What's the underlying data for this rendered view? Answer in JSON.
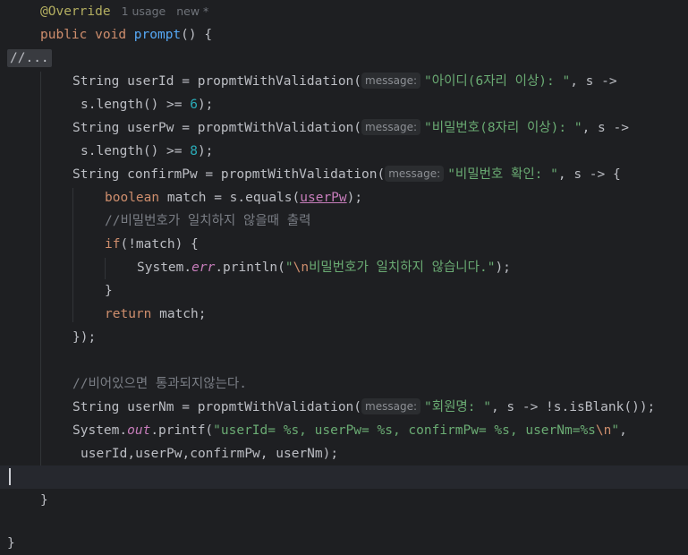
{
  "annotation": "@Override",
  "usage": "1 usage",
  "status": "new *",
  "sig": {
    "kw1": "public",
    "kw2": "void",
    "name": "prompt",
    "rest": "() {"
  },
  "fold": "//...",
  "userId": {
    "a": "String userId = ",
    "fn": "propmtWithValidation(",
    "hint": "message:",
    "str": "\"아이디(6자리 이상): \"",
    "b": ", s ->",
    "c": "s.length() >= ",
    "num": "6",
    "d": ");"
  },
  "userPw": {
    "a": "String userPw = ",
    "fn": "propmtWithValidation(",
    "hint": "message:",
    "str": "\"비밀번호(8자리 이상): \"",
    "b": ", s ->",
    "c": "s.length() >= ",
    "num": "8",
    "d": ");"
  },
  "confirm": {
    "a": "String confirmPw = ",
    "fn": "propmtWithValidation(",
    "hint": "message:",
    "str": "\"비밀번호 확인: \"",
    "b": ", s -> {"
  },
  "match": {
    "kw": "boolean",
    "a": " match = s.equals(",
    "var": "userPw",
    "b": ");"
  },
  "comment1": "//비밀번호가 일치하지 않을때 출력",
  "ifline": {
    "kw": "if",
    "a": "(!match) {"
  },
  "println": {
    "a": "System.",
    "st": "err",
    "b": ".println(",
    "s1": "\"",
    "esc": "\\n",
    "s2": "비밀번호가 일치하지 않습니다.\"",
    "c": ");"
  },
  "closeBrace": "}",
  "ret": {
    "kw": "return",
    "a": " match;"
  },
  "closeCall": "});",
  "comment2": "//비어있으면 통과되지않는다.",
  "userNm": {
    "a": "String userNm = ",
    "fn": "propmtWithValidation(",
    "hint": "message:",
    "str": "\"회원명: \"",
    "b": ", s -> !s.isBlank());"
  },
  "printf": {
    "a": "System.",
    "st": "out",
    "b": ".printf(",
    "s1": "\"userId= %s, userPw= %s, confirmPw= %s, userNm=%s",
    "esc": "\\n",
    "s2": "\"",
    "c": ","
  },
  "args": "userId,userPw,confirmPw, userNm);",
  "methodClose": "}",
  "classClose": "}"
}
